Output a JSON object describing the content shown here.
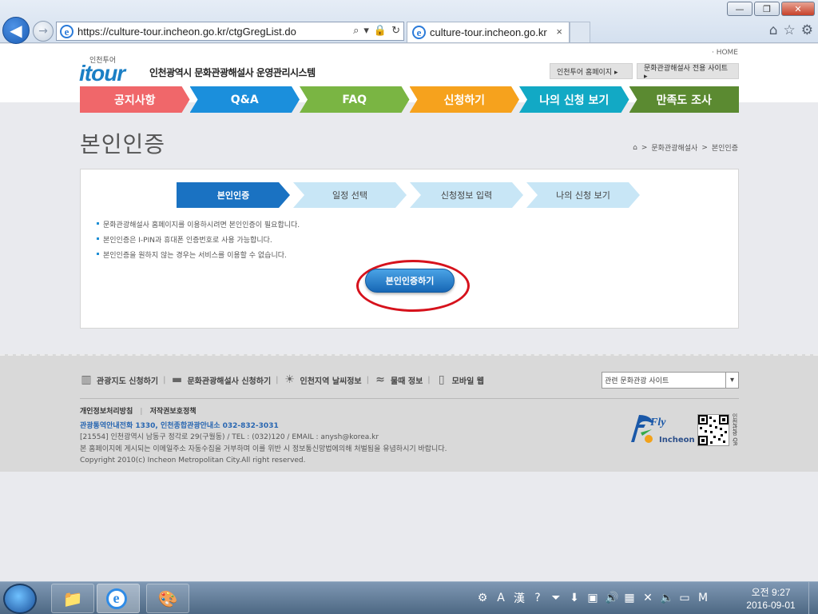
{
  "browser": {
    "url": "https://culture-tour.incheon.go.kr/ctgGregList.do",
    "tab_title": "culture-tour.incheon.go.kr",
    "tab_close": "×",
    "back_icon": "◀",
    "forward_icon": "→",
    "window": {
      "minimize": "—",
      "maximize": "❐",
      "close": "✕"
    },
    "tools": [
      "⌂",
      "☆",
      "⚙"
    ]
  },
  "header": {
    "logo_small": "인천투어",
    "logo_big": "itour",
    "site_title": "인천광역시 문화관광해설사 운영관리시스템",
    "home_link": "· HOME",
    "btn_incheon_tour": "인천투어 홈페이지 ▸",
    "btn_guide_site": "문화관광해설사 전용 사이트 ▸"
  },
  "menu": [
    {
      "label": "공지사항",
      "color": "#f0676a"
    },
    {
      "label": "Q&A",
      "color": "#1b8fdc"
    },
    {
      "label": "FAQ",
      "color": "#7ab543"
    },
    {
      "label": "신청하기",
      "color": "#f6a21d"
    },
    {
      "label": "나의 신청 보기",
      "color": "#12a9c5"
    },
    {
      "label": "만족도 조사",
      "color": "#5b8a31"
    }
  ],
  "page": {
    "title": "본인인증",
    "breadcrumb": {
      "home_icon": "⌂",
      "sep": ">",
      "section": "문화관광해설사",
      "current": "본인인증"
    }
  },
  "steps": [
    {
      "label": "본인인증",
      "active": true
    },
    {
      "label": "일정 선택",
      "active": false
    },
    {
      "label": "신청정보 입력",
      "active": false
    },
    {
      "label": "나의 신청 보기",
      "active": false
    }
  ],
  "notices": [
    "문화관광해설사 홈페이지를 이용하시려면 본인인증이 필요합니다.",
    "본인인증은 I-PIN과 휴대폰 인증번호로 사용 가능합니다.",
    "본인인증을 원하지 않는 경우는 서비스를 이용할 수 없습니다."
  ],
  "cert_button": "본인인증하기",
  "footer": {
    "links": [
      {
        "icon": "▥",
        "label": "관광지도 신청하기"
      },
      {
        "icon": "▬",
        "label": "문화관광해설사 신청하기"
      },
      {
        "icon": "☀",
        "label": "인천지역 날씨정보"
      },
      {
        "icon": "≈",
        "label": "물때 정보"
      },
      {
        "icon": "▯",
        "label": "모바일 웹"
      }
    ],
    "separator": "|",
    "select_value": "관련 문화관광 사이트",
    "select_arrow": "▾",
    "policy": "개인정보처리방침",
    "policy_sep": "|",
    "copyright_policy": "저작권보호정책",
    "tel": "관광통역안내전화 1330, 인천종합관광안내소 032-832-3031",
    "address": "[21554] 인천광역시 남동구 정각로 29(구월동) / TEL : (032)120 / EMAIL : anysh@korea.kr",
    "email_notice": "본 홈페이지에 게시되는 이메일주소 자동수집을 거부하며 이를 위반 시 정보통신망법에의해 처벌됨을 유념하시기 바랍니다.",
    "copyright": "Copyright 2010(c) Incheon Metropolitan City.All right reserved.",
    "fly_logo": "Fly",
    "fly_logo_city": "Incheon",
    "qr_label": "인천관광 QR"
  },
  "taskbar": {
    "start_icon": "⊞",
    "apps": [
      {
        "name": "explorer",
        "icon": "📁"
      },
      {
        "name": "internet-explorer",
        "icon": "e"
      },
      {
        "name": "paint",
        "icon": "🎨"
      }
    ],
    "tray": [
      "⚙",
      "A",
      "漢",
      "?",
      "⏷",
      "⬇",
      "▣",
      "🔊",
      "▦",
      "✕",
      "🔈",
      "▭",
      "M"
    ],
    "time": "오전 9:27",
    "date": "2016-09-01"
  }
}
